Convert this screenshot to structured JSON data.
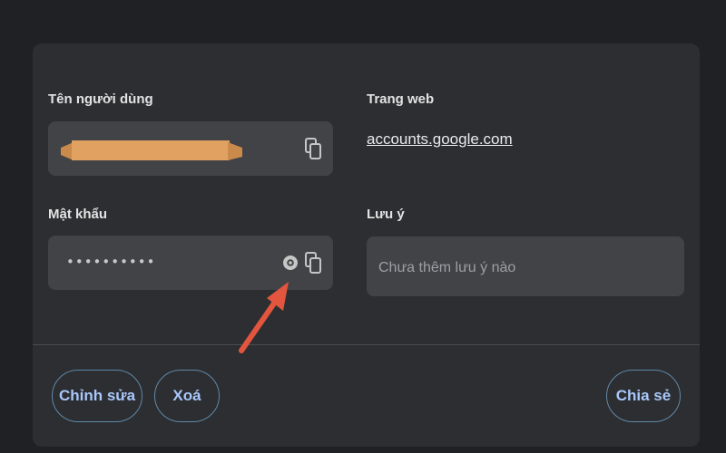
{
  "username": {
    "label": "Tên người dùng",
    "copy_icon": "copy-icon",
    "redaction_color": "#e0a161"
  },
  "website": {
    "label": "Trang web",
    "link": "accounts.google.com"
  },
  "password": {
    "label": "Mật khẩu",
    "masked_value": "••••••••••",
    "show_icon": "eye-icon",
    "copy_icon": "copy-icon"
  },
  "note": {
    "label": "Lưu ý",
    "placeholder": "Chưa thêm lưu ý nào"
  },
  "actions": {
    "edit_label": "Chỉnh sửa",
    "delete_label": "Xoá",
    "share_label": "Chia sẻ"
  },
  "colors": {
    "accent": "#a8c7fa",
    "annotation_arrow": "#e2553e"
  }
}
